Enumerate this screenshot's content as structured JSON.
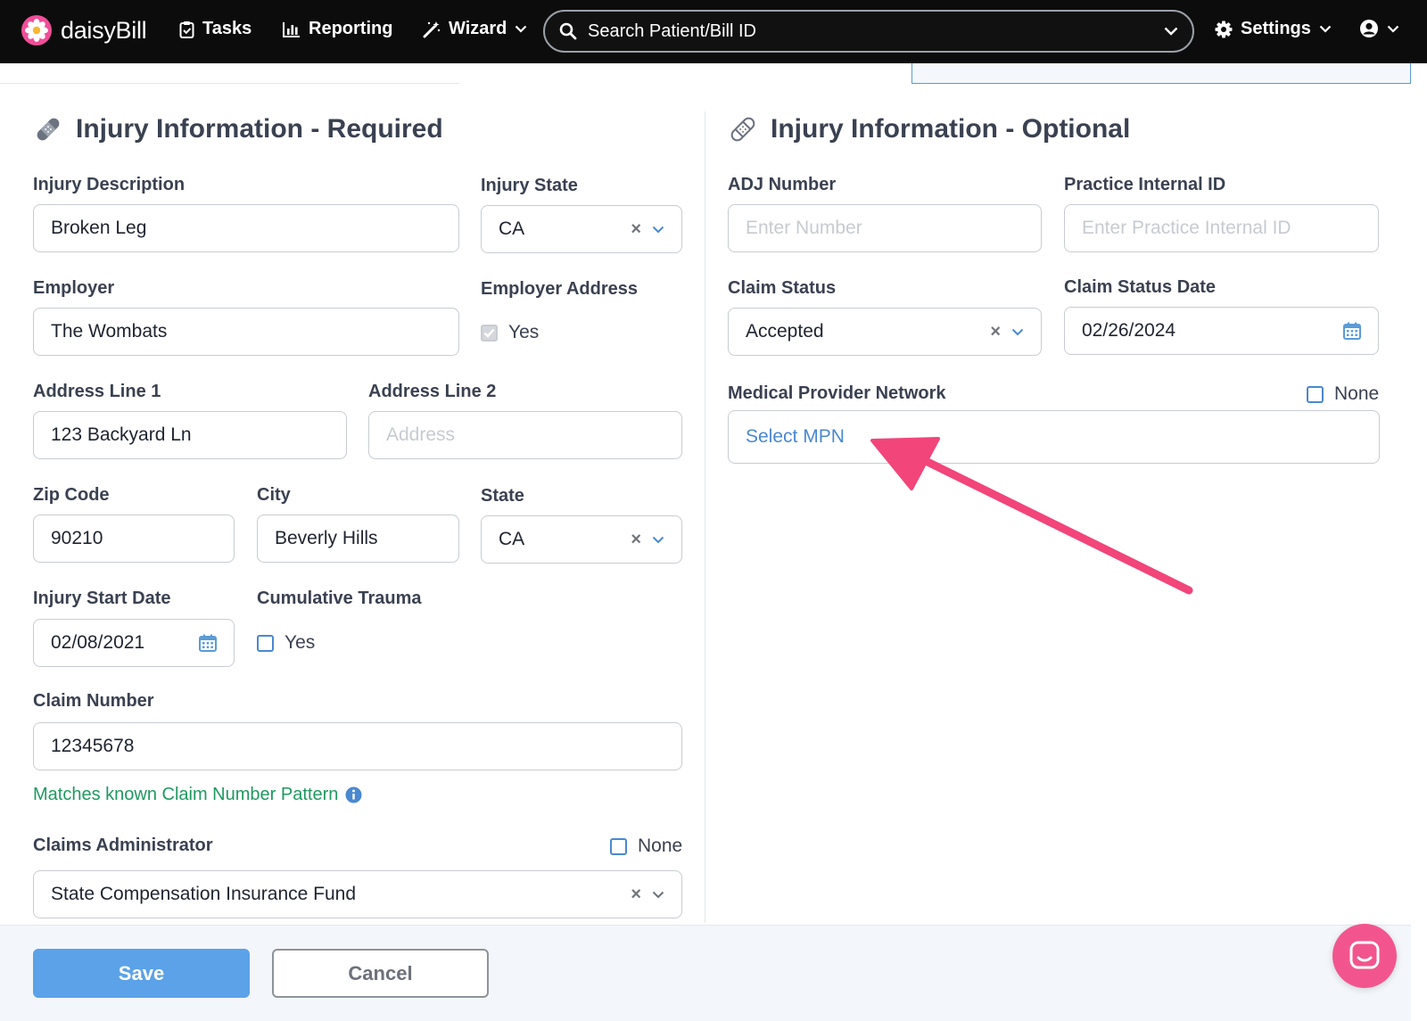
{
  "nav": {
    "brand": "daisyBill",
    "tasks": "Tasks",
    "reporting": "Reporting",
    "wizard": "Wizard",
    "search_placeholder": "Search Patient/Bill ID",
    "settings": "Settings"
  },
  "required": {
    "title": "Injury Information - Required",
    "injury_description": {
      "label": "Injury Description",
      "value": "Broken Leg"
    },
    "injury_state": {
      "label": "Injury State",
      "value": "CA"
    },
    "employer": {
      "label": "Employer",
      "value": "The Wombats"
    },
    "employer_address": {
      "label": "Employer Address",
      "checkbox_label": "Yes",
      "checked": true
    },
    "address_line_1": {
      "label": "Address Line 1",
      "value": "123 Backyard Ln"
    },
    "address_line_2": {
      "label": "Address Line 2",
      "placeholder": "Address"
    },
    "zip_code": {
      "label": "Zip Code",
      "value": "90210"
    },
    "city": {
      "label": "City",
      "value": "Beverly Hills"
    },
    "state": {
      "label": "State",
      "value": "CA"
    },
    "injury_start_date": {
      "label": "Injury Start Date",
      "value": "02/08/2021"
    },
    "cumulative_trauma": {
      "label": "Cumulative Trauma",
      "checkbox_label": "Yes",
      "checked": false
    },
    "claim_number": {
      "label": "Claim Number",
      "value": "12345678",
      "hint": "Matches known Claim Number Pattern"
    },
    "claims_administrator": {
      "label": "Claims Administrator",
      "none_label": "None",
      "value": "State Compensation Insurance Fund"
    }
  },
  "optional": {
    "title": "Injury Information - Optional",
    "adj_number": {
      "label": "ADJ Number",
      "placeholder": "Enter Number"
    },
    "practice_internal_id": {
      "label": "Practice Internal ID",
      "placeholder": "Enter Practice Internal ID"
    },
    "claim_status": {
      "label": "Claim Status",
      "value": "Accepted"
    },
    "claim_status_date": {
      "label": "Claim Status Date",
      "value": "02/26/2024"
    },
    "mpn": {
      "label": "Medical Provider Network",
      "none_label": "None",
      "placeholder": "Select MPN"
    }
  },
  "footer": {
    "save": "Save",
    "cancel": "Cancel"
  },
  "colors": {
    "accent": "#5ba2e8",
    "annotation_arrow": "#f2457a",
    "success": "#1f9960",
    "chat": "#f2558e"
  }
}
